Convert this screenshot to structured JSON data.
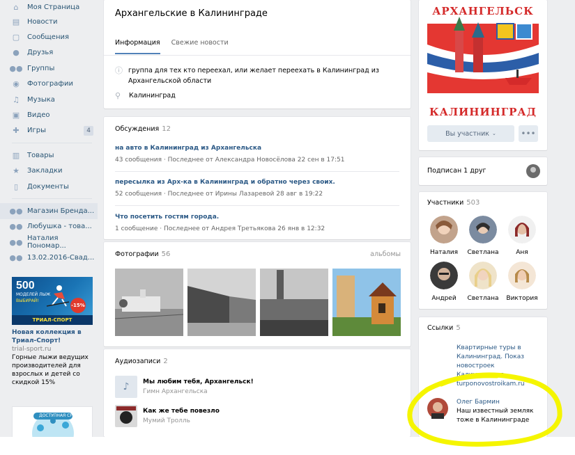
{
  "nav": {
    "items": [
      {
        "label": "Моя Страница",
        "icon": "home-icon"
      },
      {
        "label": "Новости",
        "icon": "news-icon"
      },
      {
        "label": "Сообщения",
        "icon": "messages-icon"
      },
      {
        "label": "Друзья",
        "icon": "friends-icon"
      },
      {
        "label": "Группы",
        "icon": "groups-icon"
      },
      {
        "label": "Фотографии",
        "icon": "camera-icon"
      },
      {
        "label": "Музыка",
        "icon": "music-icon"
      },
      {
        "label": "Видео",
        "icon": "video-icon"
      },
      {
        "label": "Игры",
        "icon": "gamepad-icon",
        "badge": "4"
      }
    ],
    "items2": [
      {
        "label": "Товары",
        "icon": "bag-icon"
      },
      {
        "label": "Закладки",
        "icon": "star-icon"
      },
      {
        "label": "Документы",
        "icon": "document-icon"
      }
    ],
    "items3": [
      {
        "label": "Магазин Бренда..."
      },
      {
        "label": "Любушка - това..."
      },
      {
        "label": "Наталия Пономар..."
      },
      {
        "label": "13.02.2016-Свад..."
      }
    ]
  },
  "ad": {
    "big_number": "500",
    "subtitle": "МОДЕЛЕЙ ЛЫЖ",
    "choose": "ВЫБИРАЙ!",
    "discount": "-15%",
    "brand": "ТРИАЛ-СПОРТ",
    "title": "Новая коллекция в Триал-Спорт!",
    "domain": "trial-sport.ru",
    "text": "Горные лыжи ведущих производителей для взрослых и детей со скидкой 15%",
    "banner2": "ДОСТУПНАЯ СРЕДА"
  },
  "group": {
    "title": "Архангельские в Калининграде",
    "tabs": [
      "Информация",
      "Свежие новости"
    ],
    "description": "группа для тех кто переехал, или желает переехать в Калининград из Архангельской области",
    "location": "Калининград"
  },
  "discussions": {
    "title": "Обсуждения",
    "count": "12",
    "topics": [
      {
        "title": "на авто в Калининград из Архангельска",
        "count": "43 сообщения",
        "last": "Последнее от Александра Новосёлова 22 сен в 17:51"
      },
      {
        "title": "пересылка из Арх-ка в Калининград и обратно через своих.",
        "count": "52 сообщения",
        "last": "Последнее от Ирины Лазаревой 28 авг в 19:22"
      },
      {
        "title": "Что посетить гостям города.",
        "count": "1 сообщение",
        "last": "Последнее от Андрея Третьякова 26 янв в 12:32"
      }
    ]
  },
  "photos": {
    "title": "Фотографии",
    "count": "56",
    "albums": "альбомы"
  },
  "audio": {
    "title": "Аудиозаписи",
    "count": "2",
    "tracks": [
      {
        "title": "Мы любим тебя, Архангельск!",
        "artist": "Гимн Архангельска"
      },
      {
        "title": "Как же тебе повезло",
        "artist": "Мумий Тролль"
      }
    ]
  },
  "cover": {
    "top": "АРХАНГЕЛЬСК",
    "bottom": "КАЛИНИНГРАД"
  },
  "membership": {
    "button": "Вы участник",
    "more": "•••"
  },
  "friends": {
    "label": "Подписан 1 друг"
  },
  "members": {
    "title": "Участники",
    "count": "503",
    "people": [
      "Наталия",
      "Светлана",
      "Аня",
      "Андрей",
      "Светлана",
      "Виктория"
    ]
  },
  "links": {
    "title": "Ссылки",
    "count": "5",
    "items": [
      {
        "title": "Квартирные туры в Калининград. Показ новостроек Калининграда",
        "domain": "turponovostroikam.ru"
      },
      {
        "title": "Олег Бармин",
        "text": "Наш известный земляк тоже в Калининграде"
      }
    ]
  },
  "colors": {
    "link": "#2a5885",
    "accent": "#5181b8",
    "bg": "#edeef0",
    "highlight": "#f5f500"
  }
}
